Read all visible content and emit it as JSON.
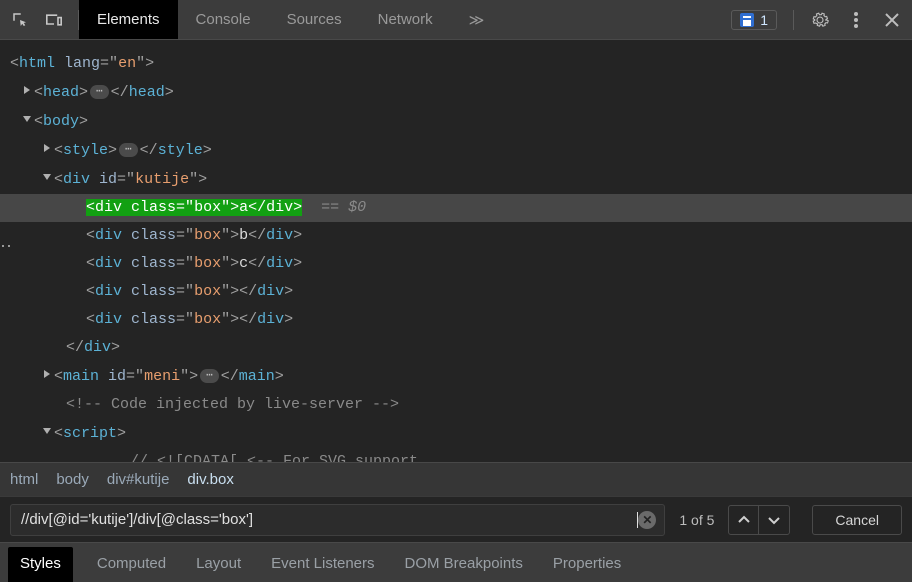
{
  "toolbar": {
    "tabs": [
      "Elements",
      "Console",
      "Sources",
      "Network"
    ],
    "activeTab": "Elements",
    "more": "≫",
    "issues": "1"
  },
  "dom": {
    "html_open": "<html lang=\"en\">",
    "head_open": "<head>",
    "head_close": "</head>",
    "body_open": "<body>",
    "style_open": "<style>",
    "style_close": "</style>",
    "div_kutije_open": "<div id=\"kutije\">",
    "selected_line": "<div class=\"box\">a</div>",
    "eq0": "== $0",
    "box_b": {
      "pre": "<div class=\"box\">",
      "txt": "b",
      "post": "</div>"
    },
    "box_c": {
      "pre": "<div class=\"box\">",
      "txt": "c",
      "post": "</div>"
    },
    "box_e1": {
      "pre": "<div class=\"box\">",
      "post": "</div>"
    },
    "box_e2": {
      "pre": "<div class=\"box\">",
      "post": "</div>"
    },
    "div_close": "</div>",
    "main_open": "<main id=\"meni\">",
    "main_close": "</main>",
    "comment": "<!-- Code injected by live-server -->",
    "script_open": "<script>",
    "cdata": "// <![CDATA[  <-- For SVG support"
  },
  "breadcrumb": {
    "items": [
      "html",
      "body",
      "div#kutije",
      "div.box"
    ],
    "active": "div.box"
  },
  "search": {
    "value": "//div[@id='kutije']/div[@class='box']",
    "match": "1 of 5",
    "cancel": "Cancel"
  },
  "bottom": {
    "tabs": [
      "Styles",
      "Computed",
      "Layout",
      "Event Listeners",
      "DOM Breakpoints",
      "Properties"
    ],
    "active": "Styles"
  }
}
